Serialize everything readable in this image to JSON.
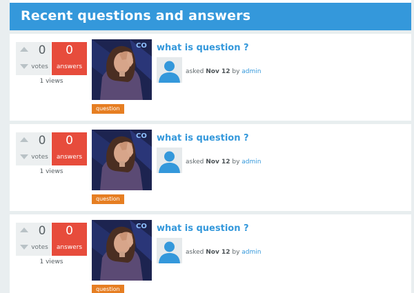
{
  "header": {
    "title": "Recent questions and answers"
  },
  "questions": [
    {
      "votes": "0",
      "votes_label": "votes",
      "answers": "0",
      "answers_label": "answers",
      "views": "1 views",
      "title": "what is question ?",
      "tag": "question",
      "asked": "asked",
      "date": "Nov 12",
      "by": "by",
      "user": "admin",
      "avatar_icon": "user-avatar-icon"
    },
    {
      "votes": "0",
      "votes_label": "votes",
      "answers": "0",
      "answers_label": "answers",
      "views": "1 views",
      "title": "what is question ?",
      "tag": "question",
      "asked": "asked",
      "date": "Nov 12",
      "by": "by",
      "user": "admin",
      "avatar_icon": "user-avatar-icon"
    },
    {
      "votes": "0",
      "votes_label": "votes",
      "answers": "0",
      "answers_label": "answers",
      "views": "1 views",
      "title": "what is question ?",
      "tag": "question",
      "asked": "asked",
      "date": "Nov 12",
      "by": "by",
      "user": "admin",
      "avatar_icon": "user-avatar-icon"
    }
  ],
  "colors": {
    "header": "#3498db",
    "answers_box": "#e74c3c",
    "tag": "#e67e22",
    "link": "#3498db"
  }
}
